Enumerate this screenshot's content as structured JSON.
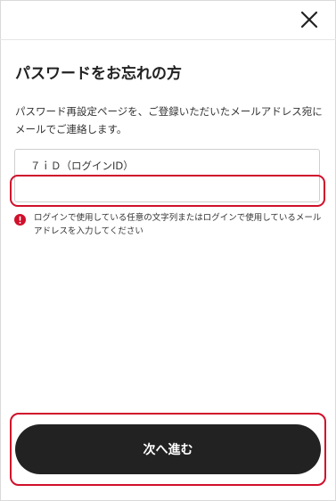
{
  "header": {
    "close_icon": "close-icon"
  },
  "page": {
    "title": "パスワードをお忘れの方",
    "description": "パスワード再設定ページを、ご登録いただいたメールアドレス宛にメールでご連絡します。"
  },
  "form": {
    "field_label": "７ｉＤ（ログインID）",
    "field_value": "",
    "field_placeholder": "",
    "error_icon": "error-icon",
    "error_message": "ログインで使用している任意の文字列またはログインで使用しているメールアドレスを入力してください"
  },
  "actions": {
    "next_label": "次へ進む"
  },
  "colors": {
    "highlight": "#d0102b",
    "button_bg": "#222222",
    "error_icon": "#d0102b"
  }
}
